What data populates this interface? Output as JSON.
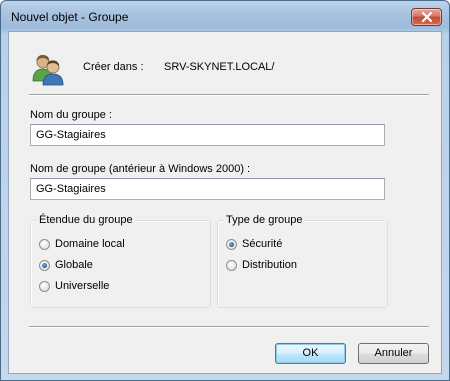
{
  "window": {
    "title": "Nouvel objet - Groupe"
  },
  "header": {
    "create_label": "Créer dans :",
    "create_value": "SRV-SKYNET.LOCAL/"
  },
  "group_name": {
    "label": "Nom du groupe :",
    "value": "GG-Stagiaires"
  },
  "group_name_legacy": {
    "label": "Nom de groupe (antérieur à Windows 2000) :",
    "value": "GG-Stagiaires"
  },
  "scope": {
    "title": "Étendue du groupe",
    "options": [
      {
        "label": "Domaine local",
        "checked": false
      },
      {
        "label": "Globale",
        "checked": true
      },
      {
        "label": "Universelle",
        "checked": false
      }
    ]
  },
  "type": {
    "title": "Type de groupe",
    "options": [
      {
        "label": "Sécurité",
        "checked": true
      },
      {
        "label": "Distribution",
        "checked": false
      }
    ]
  },
  "buttons": {
    "ok": "OK",
    "cancel": "Annuler"
  },
  "icons": {
    "close": "close-icon",
    "group": "group-users-icon"
  }
}
